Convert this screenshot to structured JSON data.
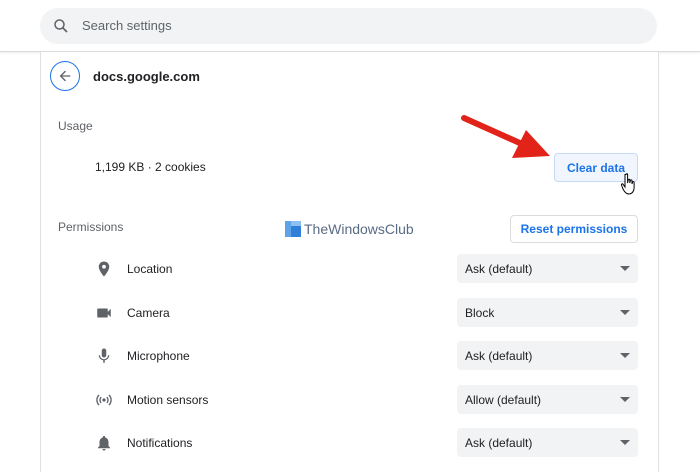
{
  "search": {
    "placeholder": "Search settings",
    "icon": "search-icon"
  },
  "site": {
    "name": "docs.google.com",
    "back_icon": "arrow-left-icon"
  },
  "usage": {
    "heading": "Usage",
    "summary": "1,199 KB · 2 cookies",
    "clear_label": "Clear data"
  },
  "permissions": {
    "heading": "Permissions",
    "reset_label": "Reset permissions",
    "items": [
      {
        "label": "Location",
        "value": "Ask (default)",
        "icon": "location-pin-icon"
      },
      {
        "label": "Camera",
        "value": "Block",
        "icon": "camera-icon"
      },
      {
        "label": "Microphone",
        "value": "Ask (default)",
        "icon": "microphone-icon"
      },
      {
        "label": "Motion sensors",
        "value": "Allow (default)",
        "icon": "motion-sensors-icon"
      },
      {
        "label": "Notifications",
        "value": "Ask (default)",
        "icon": "bell-icon"
      }
    ]
  },
  "watermark": {
    "text": "TheWindowsClub"
  },
  "colors": {
    "accent": "#1a73e8",
    "annotation_arrow": "#e2231a",
    "field_bg": "#f1f3f4"
  }
}
